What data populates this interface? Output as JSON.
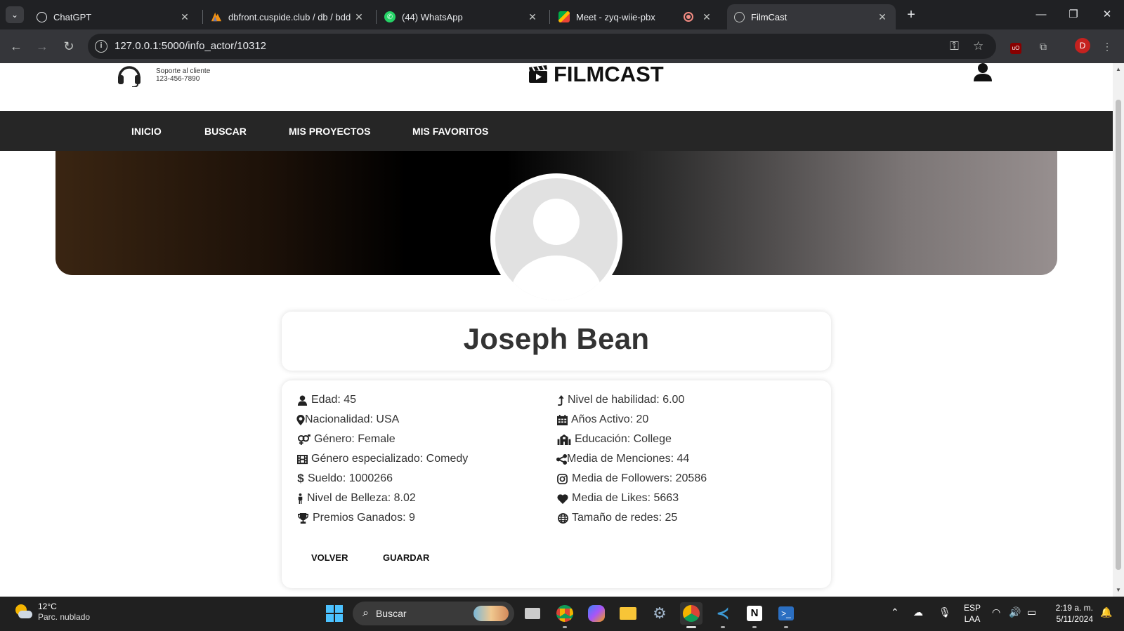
{
  "browser": {
    "tabs": [
      {
        "title": "ChatGPT"
      },
      {
        "title": "dbfront.cuspide.club / db / bdd"
      },
      {
        "title": "(44) WhatsApp"
      },
      {
        "title": "Meet - zyq-wiie-pbx"
      },
      {
        "title": "FilmCast"
      }
    ],
    "url": "127.0.0.1:5000/info_actor/10312",
    "profile_initial": "D"
  },
  "header": {
    "support_label": "Soporte al cliente",
    "support_phone": "123-456-7890",
    "brand": "FILMCAST"
  },
  "nav": {
    "items": [
      "INICIO",
      "BUSCAR",
      "MIS PROYECTOS",
      "MIS FAVORITOS"
    ]
  },
  "actor": {
    "name": "Joseph Bean",
    "left": [
      {
        "icon": "user-icon",
        "text": "Edad: 45"
      },
      {
        "icon": "location-pin-icon",
        "text": "Nacionalidad: USA"
      },
      {
        "icon": "gender-icon",
        "text": "Género: Female"
      },
      {
        "icon": "film-icon",
        "text": "Género especializado: Comedy"
      },
      {
        "icon": "dollar-icon",
        "text": "Sueldo: 1000266"
      },
      {
        "icon": "person-standing-icon",
        "text": "Nivel de Belleza: 8.02"
      },
      {
        "icon": "trophy-icon",
        "text": "Premios Ganados: 9"
      }
    ],
    "right": [
      {
        "icon": "arrow-up-icon",
        "text": "Nivel de habilidad: 6.00"
      },
      {
        "icon": "calendar-icon",
        "text": "Años Activo: 20"
      },
      {
        "icon": "school-icon",
        "text": "Educación: College"
      },
      {
        "icon": "share-icon",
        "text": "Media de Menciones: 44"
      },
      {
        "icon": "instagram-icon",
        "text": "Media de Followers: 20586"
      },
      {
        "icon": "heart-icon",
        "text": "Media de Likes: 5663"
      },
      {
        "icon": "globe-icon",
        "text": "Tamaño de redes: 25"
      }
    ],
    "buttons": {
      "back": "VOLVER",
      "save": "GUARDAR"
    }
  },
  "taskbar": {
    "weather_temp": "12°C",
    "weather_desc": "Parc. nublado",
    "search_placeholder": "Buscar",
    "lang_1": "ESP",
    "lang_2": "LAA",
    "time": "2:19 a. m.",
    "date": "5/11/2024"
  }
}
